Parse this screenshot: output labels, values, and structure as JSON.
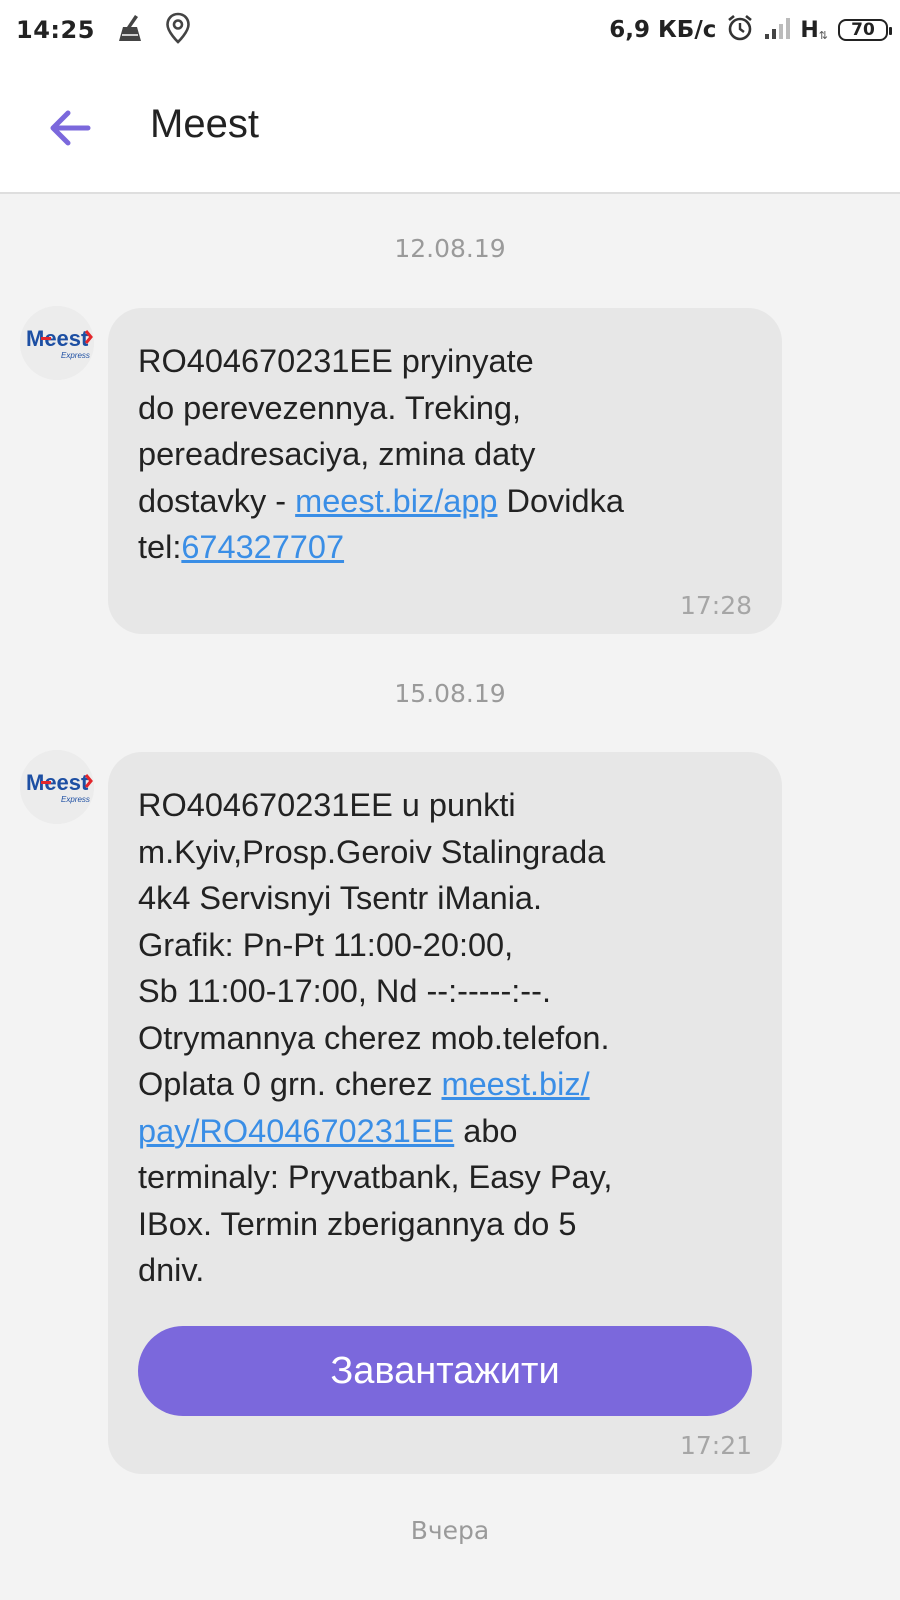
{
  "status_bar": {
    "time": "14:25",
    "net_speed": "6,9 КБ/с",
    "net_type": "H",
    "net_arrows": "⇅",
    "battery": "70",
    "icons": [
      "cleaner-icon",
      "location-pin-icon",
      "alarm-clock-icon",
      "signal-strength-icon"
    ]
  },
  "app_bar": {
    "title": "Meest",
    "back_icon": "back-arrow-icon"
  },
  "avatar": {
    "logo_text": "Meest",
    "logo_sub": "Express"
  },
  "colors": {
    "accent": "#7b68dc",
    "link": "#3a8ee6",
    "bubble": "#e7e7e7",
    "background": "#f3f3f3",
    "logo_blue": "#1d4fa3",
    "logo_red": "#e3262b"
  },
  "messages": [
    {
      "date": "12.08.19",
      "segments": [
        {
          "text": "RO404670231EE pryinyate\ndo perevezennya. Treking,\npereadresaciya, zmina daty\ndostavky - "
        },
        {
          "link": "meest.biz/app"
        },
        {
          "text": " Dovidka\ntel:"
        },
        {
          "link": "674327707"
        }
      ],
      "time": "17:28"
    },
    {
      "date": "15.08.19",
      "segments": [
        {
          "text": "RO404670231EE u punkti\nm.Kyiv,Prosp.Geroiv Stalingrada\n4k4 Servisnyi Tsentr iMania.\nGrafik: Pn-Pt 11:00-20:00,\nSb 11:00-17:00, Nd --:-----:--.\nOtrymannya cherez mob.telefon.\nOplata 0 grn. cherez "
        },
        {
          "link": "meest.biz/\npay/RO404670231EE"
        },
        {
          "text": " abo\nterminaly: Pryvatbank, Easy Pay,\nIBox. Termin zberigannya do 5\ndniv."
        }
      ],
      "button": "Завантажити",
      "time": "17:21"
    }
  ],
  "next_date": "Вчера"
}
